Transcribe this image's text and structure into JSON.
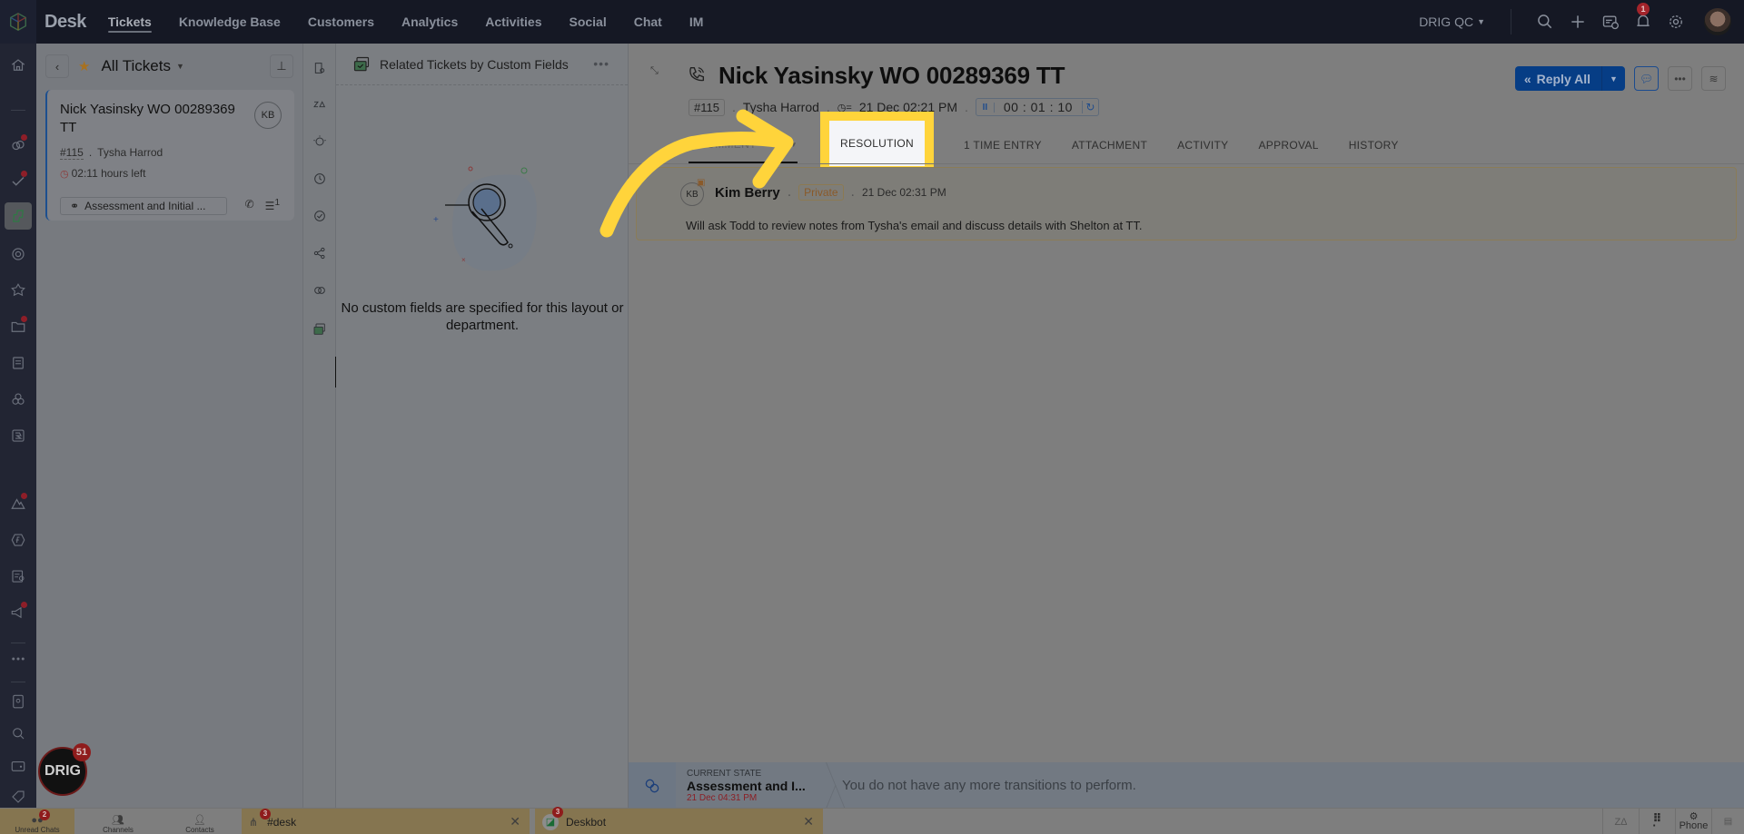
{
  "topbar": {
    "app_name": "Desk",
    "nav": [
      "Tickets",
      "Knowledge Base",
      "Customers",
      "Analytics",
      "Activities",
      "Social",
      "Chat",
      "IM"
    ],
    "active_nav": "Tickets",
    "org": "DRIG QC",
    "notification_count": "1",
    "icons": [
      "search-icon",
      "plus-icon",
      "ticket-alert-icon",
      "bell-icon",
      "gear-icon",
      "user-avatar"
    ]
  },
  "rail": {
    "icons": [
      "home-icon",
      "link-icon",
      "check-icon",
      "tickets-icon",
      "at-icon",
      "puzzle-icon",
      "folder-icon",
      "document-icon",
      "cubes-icon",
      "bold-icon",
      "mountain-icon",
      "function-icon",
      "report-icon",
      "megaphone-icon",
      "more-icon",
      "contacts-book-icon",
      "search-user-icon",
      "wallet-icon",
      "tag-icon"
    ]
  },
  "list": {
    "title": "All Tickets",
    "ticket": {
      "title": "Nick Yasinsky WO 00289369 TT",
      "assignee_initials": "KB",
      "id": "#115",
      "contact": "Tysha Harrod",
      "time_left": "02:11 hours left",
      "status": "Assessment and Initial ...",
      "thread_count": "1"
    }
  },
  "related": {
    "title": "Related Tickets by Custom Fields",
    "empty_message": "No custom fields are specified for this layout or department."
  },
  "ticket": {
    "title": "Nick Yasinsky WO 00289369 TT",
    "id": "#115",
    "contact": "Tysha Harrod",
    "due": "21 Dec 02:21 PM",
    "timer": "00 : 01 : 10",
    "reply_label": "Reply All",
    "tabs": [
      "1 COMMENT",
      "RESOLUTION",
      "1 TIME ENTRY",
      "ATTACHMENT",
      "ACTIVITY",
      "APPROVAL",
      "HISTORY"
    ],
    "highlighted_tab": "RESOLUTION",
    "comment": {
      "initials": "KB",
      "author": "Kim Berry",
      "visibility": "Private",
      "time": "21 Dec 02:31 PM",
      "body": "Will ask Todd to review notes from Tysha's email and discuss details with Shelton at TT."
    },
    "blueprint": {
      "label": "CURRENT STATE",
      "state": "Assessment and I...",
      "date": "21 Dec 04:31 PM",
      "message": "You do not have any more transitions to perform."
    }
  },
  "chatbar": {
    "unread_label": "Unread Chats",
    "unread_count": "2",
    "channels_label": "Channels",
    "contacts_label": "Contacts",
    "tabs": [
      {
        "name": "#desk",
        "count": "3"
      },
      {
        "name": "Deskbot",
        "count": "3"
      }
    ],
    "phone_label": "Phone",
    "zia_label": "Zia"
  },
  "drig_badge": {
    "text": "DRIG",
    "count": "51"
  },
  "colors": {
    "annotation": "#ffd43b",
    "primary_button": "#063d85",
    "alert_badge": "#a3242b"
  }
}
